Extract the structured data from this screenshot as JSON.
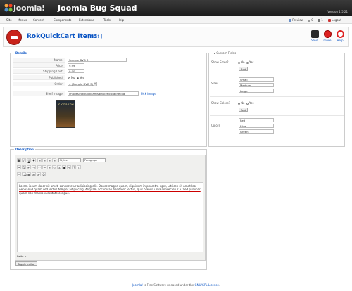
{
  "header": {
    "logo_text": "Joomla!",
    "site_title": "Joomla Bug Squad",
    "version": "Version 1.5.21"
  },
  "menu": {
    "items": [
      "Site",
      "Menus",
      "Content",
      "Components",
      "Extensions",
      "Tools",
      "Help"
    ],
    "preview": "Preview",
    "messages_count": "0",
    "users_count": "1",
    "logout": "Logout"
  },
  "toolbar": {
    "page_title": "RokQuickCart Item:",
    "edit_tag": "[ Edit ]",
    "save_label": "Save",
    "close_label": "Close",
    "help_label": "Help"
  },
  "details": {
    "legend": "Details",
    "name_label": "Name:",
    "name_value": "Sample DVD 3",
    "price_label": "Price:",
    "price_value": "9.99",
    "shipping_label": "Shipping Cost:",
    "shipping_value": "0.00",
    "published_label": "Published:",
    "no_label": "No",
    "yes_label": "Yes",
    "order_label": "Order:",
    "order_value": "4 (Sample DVD 3)",
    "shelf_label": "Shelf Image:",
    "shelf_value": "images/rokquickcart/samples/coraline.jpg",
    "pick_image": "Pick Image",
    "cover_title": "Coraline"
  },
  "custom": {
    "legend": "Custom Fields",
    "show_sizes": "Show Sizes?",
    "no_label": "No",
    "yes_label": "Yes",
    "add_label": "Add",
    "sizes_label": "Sizes",
    "sizes": [
      "Small",
      "Medium",
      "Large"
    ],
    "show_colors": "Show Colors?",
    "colors_label": "Colors",
    "colors": [
      "Red",
      "Blue",
      "Green"
    ]
  },
  "description": {
    "legend": "Description",
    "styles_select": "Styles",
    "format_select": "Paragraph",
    "body": "Lorem ipsum dolor sit amet, consectetur adipiscing elit. Donec magna quam, dignissim in pharetra eget, ultrices sit amet leo. Aenean id quam sed lectus tempor adipiscing. Aliquam accumsan hendrerit lectus, quis blandit urna consectetur a. Sed pulvinar quam non massa vulputate congue.",
    "path": "Path: p",
    "toggle": "Toggle editor"
  },
  "footer": {
    "brand": "Joomla!",
    "text_mid": " is Free Software released under the ",
    "license": "GNU/GPL License",
    "text_end": "."
  },
  "colors": {
    "accent": "#0b55c4",
    "topbar": "#1c1c1c"
  }
}
